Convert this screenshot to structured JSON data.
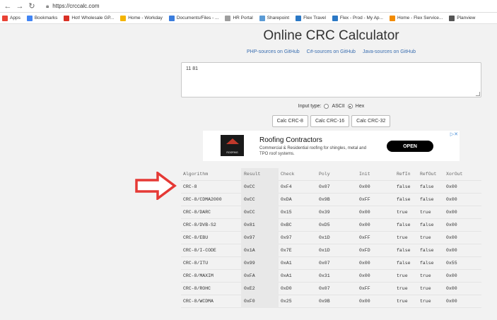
{
  "browser": {
    "url": "https://crccalc.com"
  },
  "bookmarks": [
    {
      "label": "Apps",
      "color": "#e94235"
    },
    {
      "label": "Bookmarks",
      "color": "#4285f4"
    },
    {
      "label": "Hot! Wholesale GP...",
      "color": "#d93025"
    },
    {
      "label": "Home - Workday",
      "color": "#f4b400"
    },
    {
      "label": "Documents/Files - ...",
      "color": "#3b7ddd"
    },
    {
      "label": "HR Portal",
      "color": "#9e9e9e"
    },
    {
      "label": "Sharepoint",
      "color": "#5b9bd5"
    },
    {
      "label": "Flex Travel",
      "color": "#2b78c5"
    },
    {
      "label": "Flex - Prod - My Ap...",
      "color": "#2b78c5"
    },
    {
      "label": "Home - Flex Service...",
      "color": "#f28b00"
    },
    {
      "label": "Planview",
      "color": "#555555"
    }
  ],
  "page": {
    "title": "Online CRC Calculator",
    "links": [
      "PHP-sources on GitHub",
      "C#-sources on GitHub",
      "Java-sources on GitHub"
    ],
    "input_value": "11 81",
    "input_type_label": "Input type:",
    "radio_ascii": "ASCII",
    "radio_hex": "Hex",
    "buttons": [
      "Calc CRC-8",
      "Calc CRC-16",
      "Calc CRC-32"
    ]
  },
  "ad": {
    "logo_text": "ROOFING",
    "title": "Roofing Contractors",
    "description": "Commercial & Residential roofing for shingles, metal and TPO roof systems.",
    "cta": "OPEN"
  },
  "table": {
    "headers": [
      "Algorithm",
      "Result",
      "Check",
      "Poly",
      "Init",
      "RefIn",
      "RefOut",
      "XorOut"
    ],
    "rows": [
      [
        "CRC-8",
        "0xCC",
        "0xF4",
        "0x07",
        "0x00",
        "false",
        "false",
        "0x00"
      ],
      [
        "CRC-8/CDMA2000",
        "0xCC",
        "0xDA",
        "0x9B",
        "0xFF",
        "false",
        "false",
        "0x00"
      ],
      [
        "CRC-8/DARC",
        "0xCC",
        "0x15",
        "0x39",
        "0x00",
        "true",
        "true",
        "0x00"
      ],
      [
        "CRC-8/DVB-S2",
        "0x81",
        "0xBC",
        "0xD5",
        "0x00",
        "false",
        "false",
        "0x00"
      ],
      [
        "CRC-8/EBU",
        "0x97",
        "0x97",
        "0x1D",
        "0xFF",
        "true",
        "true",
        "0x00"
      ],
      [
        "CRC-8/I-CODE",
        "0x1A",
        "0x7E",
        "0x1D",
        "0xFD",
        "false",
        "false",
        "0x00"
      ],
      [
        "CRC-8/ITU",
        "0x99",
        "0xA1",
        "0x07",
        "0x00",
        "false",
        "false",
        "0x55"
      ],
      [
        "CRC-8/MAXIM",
        "0xFA",
        "0xA1",
        "0x31",
        "0x00",
        "true",
        "true",
        "0x00"
      ],
      [
        "CRC-8/ROHC",
        "0xE2",
        "0xD0",
        "0x07",
        "0xFF",
        "true",
        "true",
        "0x00"
      ],
      [
        "CRC-8/WCDMA",
        "0xF0",
        "0x25",
        "0x9B",
        "0x00",
        "true",
        "true",
        "0x00"
      ]
    ]
  },
  "colors": {
    "arrow": "#e53935",
    "link": "#3a6eb0"
  }
}
